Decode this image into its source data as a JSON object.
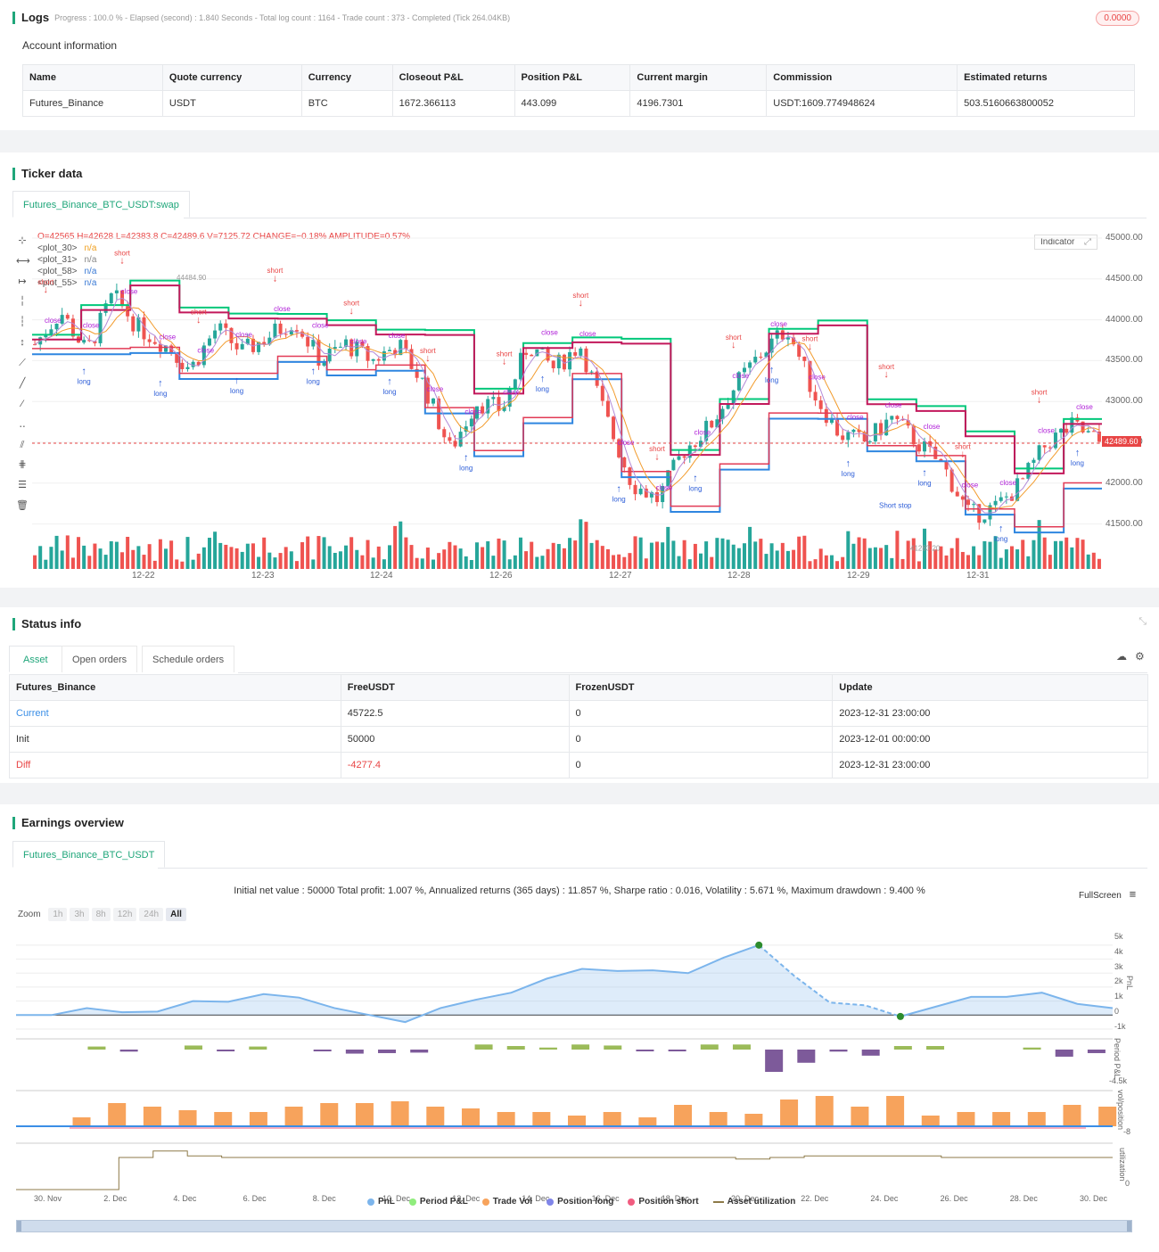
{
  "logs": {
    "title": "Logs",
    "progress": "Progress : 100.0 % - Elapsed (second) : 1.840  Seconds - Total log count : 1164 - Trade count : 373 - Completed (Tick 264.04KB)",
    "badge": "0.0000"
  },
  "account": {
    "title": "Account information",
    "headers": [
      "Name",
      "Quote currency",
      "Currency",
      "Closeout P&L",
      "Position P&L",
      "Current margin",
      "Commission",
      "Estimated returns"
    ],
    "row": [
      "Futures_Binance",
      "USDT",
      "BTC",
      "1672.366113",
      "443.099",
      "4196.7301",
      "USDT:1609.774948624",
      "503.5160663800052"
    ]
  },
  "ticker": {
    "title": "Ticker data",
    "tab": "Futures_Binance_BTC_USDT:swap",
    "ohlc": "O=42565 H=42628 L=42383.8 C=42489.6 V=7125.72 CHANGE=−0.18% AMPLITUDE=0.57%",
    "plots": [
      {
        "name": "<plot_30>",
        "value": "n/a",
        "color": "#f0a020"
      },
      {
        "name": "<plot_31>",
        "value": "n/a",
        "color": "#888888"
      },
      {
        "name": "<plot_58>",
        "value": "n/a",
        "color": "#3a7ad5"
      },
      {
        "name": "<plot_55>",
        "value": "n/a",
        "color": "#3a7ad5"
      }
    ],
    "indicator_btn": "Indicator",
    "price_ticks": [
      "45000.00",
      "44500.00",
      "44000.00",
      "43500.00",
      "43000.00",
      "42500.00",
      "42000.00",
      "41500.00"
    ],
    "last_price": "42489.60",
    "date_ticks": [
      "12-22",
      "12-23",
      "12-24",
      "12-26",
      "12-27",
      "12-28",
      "12-29",
      "12-31"
    ],
    "high_label": "44484.90",
    "low_label": "41283.20",
    "labels": {
      "short": "short",
      "long": "long",
      "close": "close",
      "short_stop": "Short stop"
    }
  },
  "status": {
    "title": "Status info",
    "tabs": [
      "Asset",
      "Open orders",
      "Schedule orders"
    ],
    "headers": [
      "Futures_Binance",
      "FreeUSDT",
      "FrozenUSDT",
      "Update"
    ],
    "rows": [
      {
        "label": "Current",
        "free": "45722.5",
        "frozen": "0",
        "update": "2023-12-31 23:00:00",
        "color": "#3a8ee6"
      },
      {
        "label": "Init",
        "free": "50000",
        "frozen": "0",
        "update": "2023-12-01 00:00:00",
        "color": "#333333"
      },
      {
        "label": "Diff",
        "free": "-4277.4",
        "frozen": "0",
        "update": "2023-12-31 23:00:00",
        "color": "#e84545"
      }
    ]
  },
  "earnings": {
    "title": "Earnings overview",
    "tab": "Futures_Binance_BTC_USDT",
    "summary": "Initial net value : 50000 Total profit: 1.007 %, Annualized returns (365 days) : 11.857 %, Sharpe ratio : 0.016, Volatility : 5.671 %, Maximum drawdown : 9.400 %",
    "fullscreen": "FullScreen",
    "zoom_label": "Zoom",
    "zoom_options": [
      "1h",
      "3h",
      "8h",
      "12h",
      "24h",
      "All"
    ],
    "pnl_ticks": [
      "5k",
      "4k",
      "3k",
      "2k",
      "1k",
      "0",
      "-1k"
    ],
    "period_ticks": [
      "-4.5k"
    ],
    "vol_ticks": [
      "-8"
    ],
    "util_ticks": [
      "0"
    ],
    "axis_titles": [
      "PnL",
      "Period P&L",
      "vol/position",
      "utilization"
    ],
    "x_ticks": [
      "30. Nov",
      "2. Dec",
      "4. Dec",
      "6. Dec",
      "8. Dec",
      "10. Dec",
      "12. Dec",
      "14. Dec",
      "16. Dec",
      "18. Dec",
      "20. Dec",
      "22. Dec",
      "24. Dec",
      "26. Dec",
      "28. Dec",
      "30. Dec"
    ],
    "legend": [
      {
        "label": "PnL",
        "color": "#7cb5ec"
      },
      {
        "label": "Period P&L",
        "color": "#90ed7d"
      },
      {
        "label": "Trade Vol",
        "color": "#f7a35c"
      },
      {
        "label": "Position long",
        "color": "#8085e9"
      },
      {
        "label": "Position short",
        "color": "#f15c80"
      },
      {
        "label": "Asset utilization",
        "color": "#8d7a48"
      }
    ],
    "chart_data": [
      {
        "type": "area",
        "series": [
          {
            "name": "PnL",
            "values": [
              0,
              0,
              500,
              200,
              250,
              1000,
              950,
              1500,
              1250,
              500,
              0,
              -500,
              500,
              1100,
              1600,
              2600,
              3300,
              3150,
              3200,
              3000,
              4100,
              5000,
              2800,
              900,
              700,
              -100,
              600,
              1300,
              1300,
              1600,
              800,
              500
            ]
          }
        ],
        "ylim": [
          -1000,
          5000
        ]
      },
      {
        "type": "bar",
        "series": [
          {
            "name": "Period P&L",
            "values": [
              0,
              0,
              300,
              -200,
              0,
              400,
              -100,
              300,
              0,
              -150,
              -400,
              -350,
              -300,
              0,
              500,
              350,
              200,
              500,
              400,
              -150,
              -100,
              500,
              500,
              -2200,
              -1300,
              -200,
              -600,
              350,
              350,
              0,
              0,
              200,
              -700,
              -350
            ]
          }
        ]
      },
      {
        "type": "bar",
        "series": [
          {
            "name": "Trade Vol",
            "values": [
              0,
              5,
              13,
              11,
              9,
              8,
              8,
              11,
              13,
              13,
              14,
              11,
              10,
              8,
              8,
              6,
              8,
              5,
              12,
              8,
              7,
              15,
              17,
              11,
              17,
              6,
              8,
              8,
              8,
              12,
              11
            ]
          }
        ]
      },
      {
        "type": "line",
        "series": [
          {
            "name": "Asset utilization",
            "values": [
              0,
              0,
              0,
              2.0,
              2.4,
              2.1,
              2.0,
              2.0,
              2.0,
              2.0,
              2.0,
              2.0,
              2.0,
              2.0,
              2.0,
              2.0,
              2.0,
              2.0,
              2.0,
              2.0,
              2.0,
              1.9,
              2.0,
              2.1,
              2.1,
              2.1,
              2.1,
              2.0,
              2.0,
              2.0,
              2.0,
              2.0
            ]
          }
        ]
      }
    ]
  }
}
